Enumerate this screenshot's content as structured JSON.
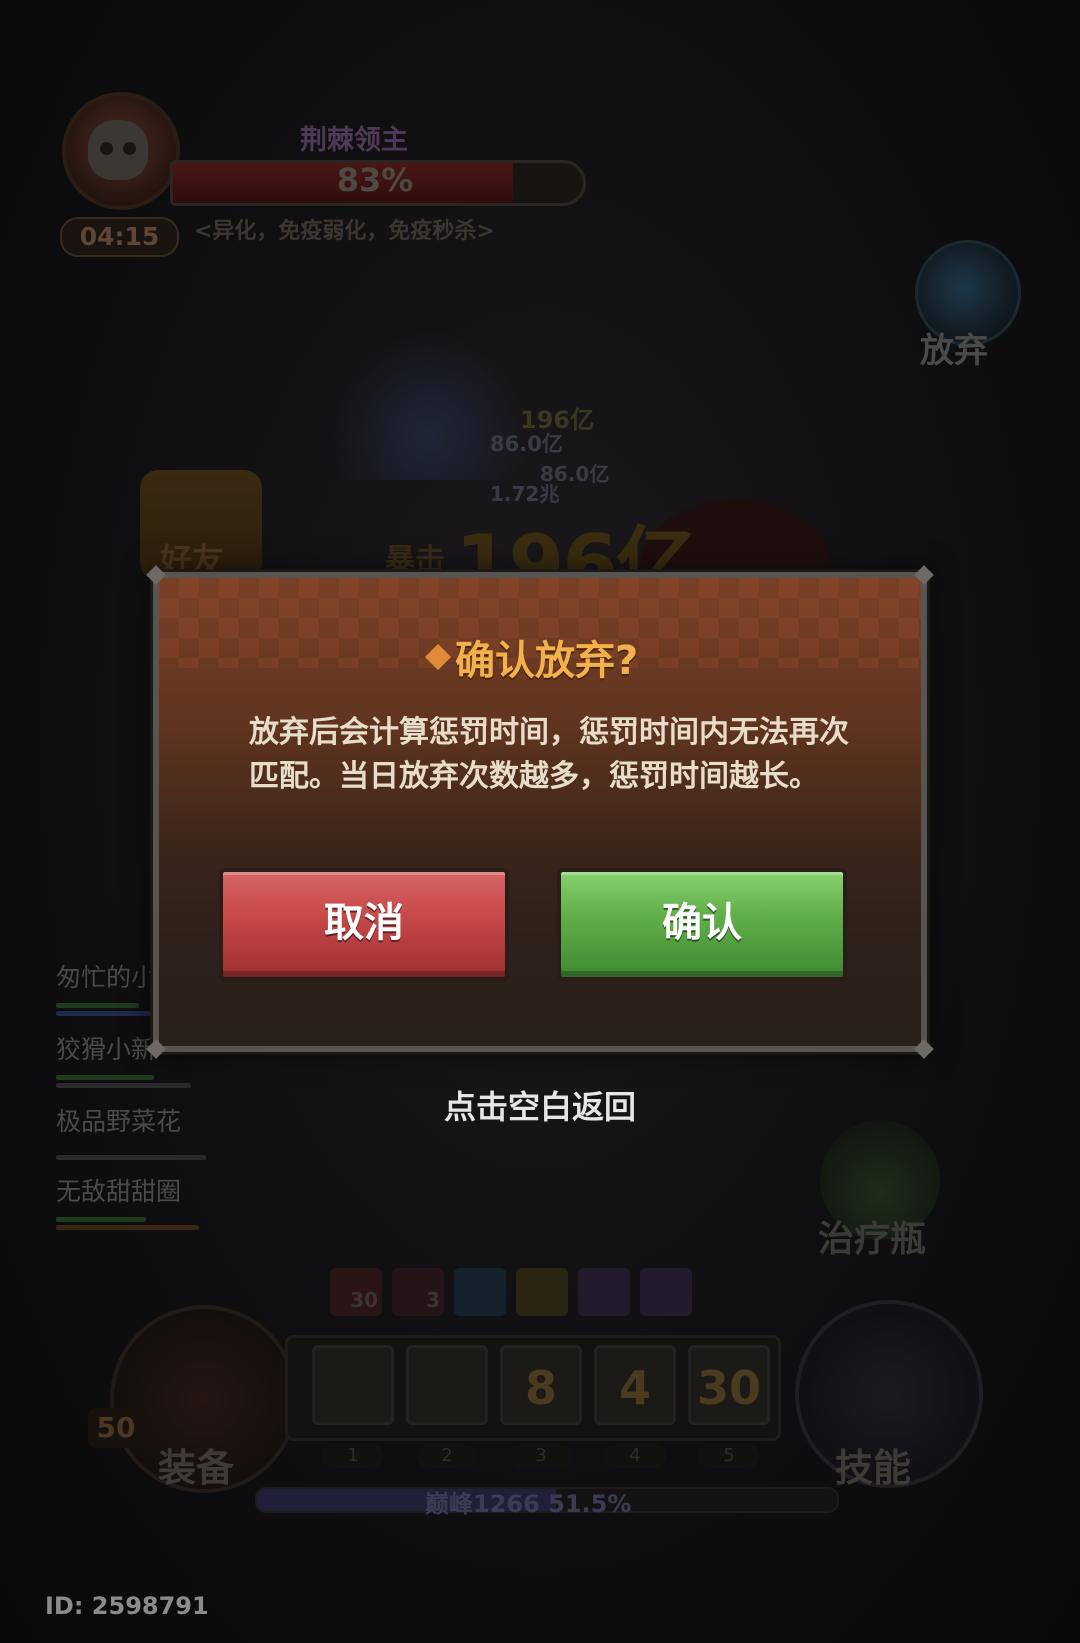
{
  "boss": {
    "name": "荆棘领主",
    "hp_percent_label": "83%",
    "hp_fraction": 0.83,
    "traits": "<异化，免疫弱化，免疫秒杀>",
    "timer": "04:15"
  },
  "side_buttons": {
    "abandon": "放弃",
    "friend": "好友",
    "potion": "治疗瓶",
    "equip": "装备",
    "skill": "技能",
    "equip_level": "50"
  },
  "combat_text": {
    "crit_label": "暴击",
    "crit_value": "196亿",
    "floating": [
      "86.0亿",
      "86.0亿",
      "1.72兆",
      "196亿"
    ]
  },
  "team": [
    {
      "name": "匆忙的小",
      "hp": 0.55,
      "mp": 0.95
    },
    {
      "name": "狡猾小新",
      "hp": 0.65,
      "mp": 0.9
    },
    {
      "name": "极品野菜花",
      "hp": 0.0,
      "mp": 1.0
    },
    {
      "name": "无敌甜甜圈",
      "hp": 0.6,
      "mp": 0.95
    }
  ],
  "buffs": [
    "30",
    "3",
    "",
    "",
    "",
    ""
  ],
  "skill_slots": [
    {
      "num": "1",
      "cooldown": ""
    },
    {
      "num": "2",
      "cooldown": ""
    },
    {
      "num": "3",
      "cooldown": "8"
    },
    {
      "num": "4",
      "cooldown": "4"
    },
    {
      "num": "5",
      "cooldown": "30"
    }
  ],
  "progress": {
    "label": "巅峰1266  51.5%",
    "fraction": 0.515
  },
  "player_id": "ID: 2598791",
  "modal": {
    "title": "确认放弃?",
    "message": "放弃后会计算惩罚时间，惩罚时间内无法再次匹配。当日放弃次数越多，惩罚时间越长。",
    "cancel_label": "取消",
    "confirm_label": "确认"
  },
  "tap_blank_to_return": "点击空白返回",
  "colors": {
    "modal_title": "#f3b14b",
    "cancel": "#c84a4a",
    "confirm": "#62b04a"
  }
}
